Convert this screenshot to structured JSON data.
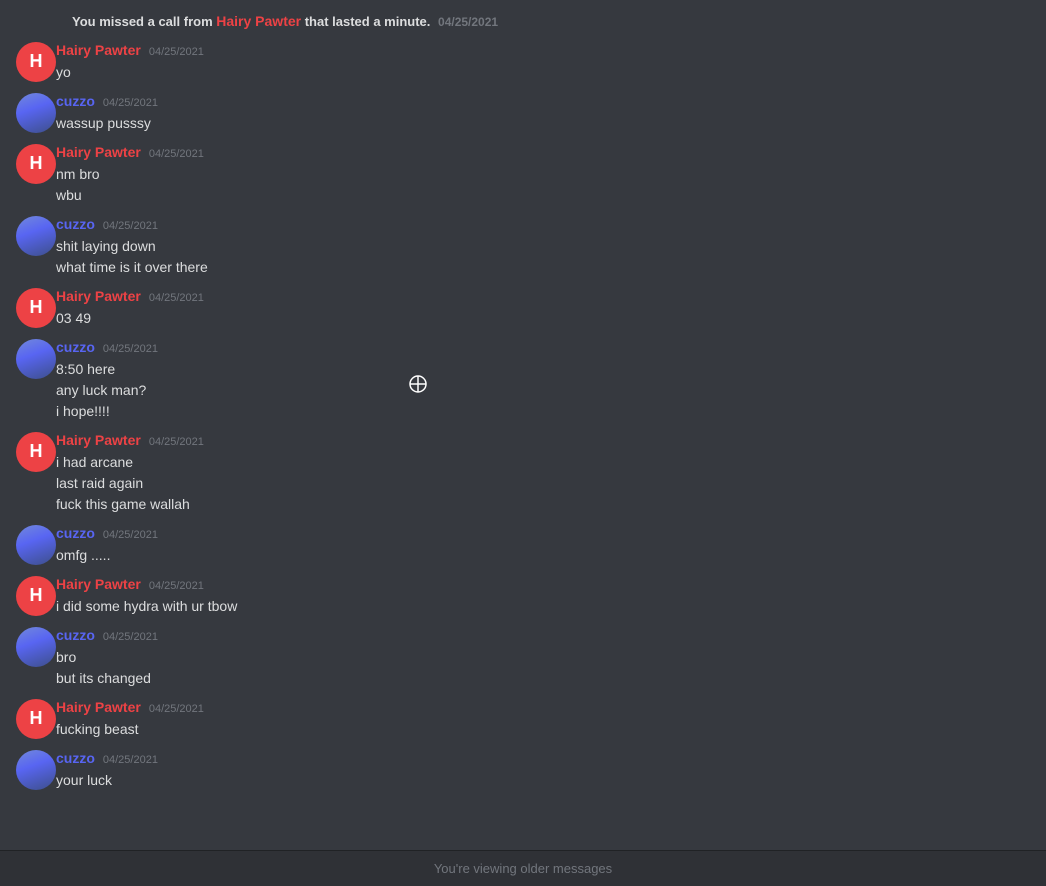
{
  "messages": [
    {
      "id": "sys1",
      "type": "system",
      "text": "You missed a call from",
      "bold": "Hairy Pawter",
      "text2": "that lasted a minute.",
      "timestamp": "04/25/2021"
    },
    {
      "id": "msg1",
      "type": "group-start",
      "author": "Hairy Pawter",
      "author_type": "hairy",
      "timestamp": "04/25/2021",
      "lines": [
        "yo"
      ]
    },
    {
      "id": "msg2",
      "type": "group-start",
      "author": "cuzzo",
      "author_type": "cuzzo",
      "timestamp": "04/25/2021",
      "lines": [
        "wassup pusssy"
      ]
    },
    {
      "id": "msg3",
      "type": "group-start",
      "author": "Hairy Pawter",
      "author_type": "hairy",
      "timestamp": "04/25/2021",
      "lines": [
        "nm bro",
        "wbu"
      ]
    },
    {
      "id": "msg4",
      "type": "group-start",
      "author": "cuzzo",
      "author_type": "cuzzo",
      "timestamp": "04/25/2021",
      "lines": [
        "shit laying down",
        "what time is it over there"
      ]
    },
    {
      "id": "msg5",
      "type": "group-start",
      "author": "Hairy Pawter",
      "author_type": "hairy",
      "timestamp": "04/25/2021",
      "lines": [
        "03 49"
      ]
    },
    {
      "id": "msg6",
      "type": "group-start",
      "author": "cuzzo",
      "author_type": "cuzzo",
      "timestamp": "04/25/2021",
      "lines": [
        "8:50 here",
        "any luck man?",
        "i hope!!!!"
      ]
    },
    {
      "id": "msg7",
      "type": "group-start",
      "author": "Hairy Pawter",
      "author_type": "hairy",
      "timestamp": "04/25/2021",
      "lines": [
        "i had arcane",
        "last raid again",
        "fuck this game wallah"
      ]
    },
    {
      "id": "msg8",
      "type": "group-start",
      "author": "cuzzo",
      "author_type": "cuzzo",
      "timestamp": "04/25/2021",
      "lines": [
        "omfg ....."
      ]
    },
    {
      "id": "msg9",
      "type": "group-start",
      "author": "Hairy Pawter",
      "author_type": "hairy",
      "timestamp": "04/25/2021",
      "lines": [
        "i did some hydra with ur tbow"
      ]
    },
    {
      "id": "msg10",
      "type": "group-start",
      "author": "cuzzo",
      "author_type": "cuzzo",
      "timestamp": "04/25/2021",
      "lines": [
        "bro",
        "but its changed"
      ]
    },
    {
      "id": "msg11",
      "type": "group-start",
      "author": "Hairy Pawter",
      "author_type": "hairy",
      "timestamp": "04/25/2021",
      "lines": [
        "fucking beast"
      ]
    },
    {
      "id": "msg12",
      "type": "group-start",
      "author": "cuzzo",
      "author_type": "cuzzo",
      "timestamp": "04/25/2021",
      "lines": [
        "your luck"
      ]
    }
  ],
  "bottom_bar": {
    "text": "You're viewing older messages"
  }
}
